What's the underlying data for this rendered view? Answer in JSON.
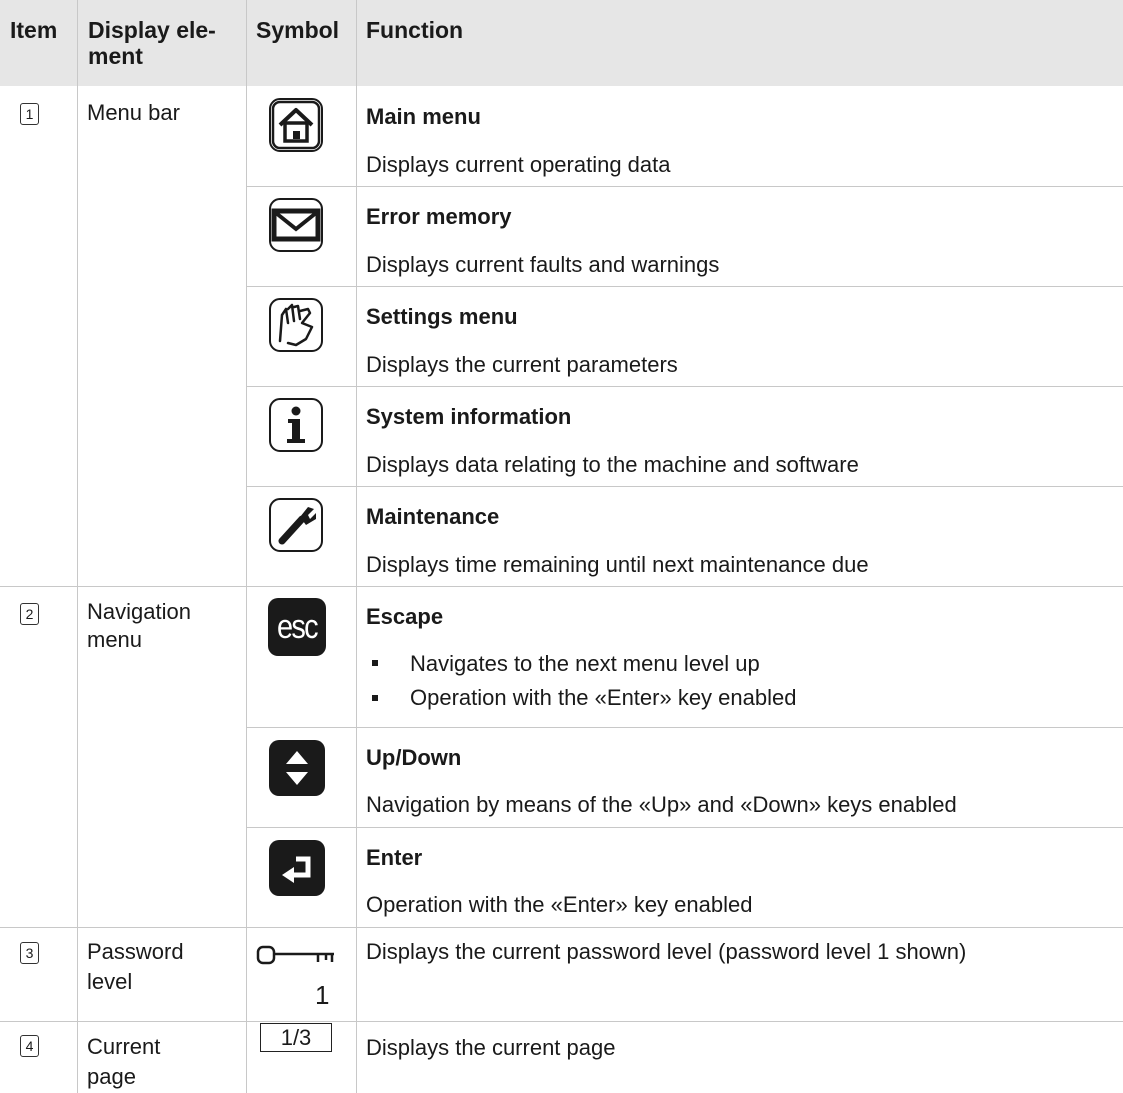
{
  "header": {
    "item": "Item",
    "display_element_line1": "Display ele-",
    "display_element_line2": "ment",
    "symbol": "Symbol",
    "function": "Function"
  },
  "rows": {
    "menu_bar": {
      "item_no": "1",
      "element": "Menu bar",
      "entries": [
        {
          "icon": "home-icon",
          "title": "Main menu",
          "desc": "Displays current operating data"
        },
        {
          "icon": "envelope-icon",
          "title": "Error memory",
          "desc": "Displays current faults and warnings"
        },
        {
          "icon": "hand-icon",
          "title": "Settings menu",
          "desc": "Displays the current parameters"
        },
        {
          "icon": "info-icon",
          "title": "System information",
          "desc": "Displays data relating to the machine and software"
        },
        {
          "icon": "wrench-icon",
          "title": "Maintenance",
          "desc": "Displays time remaining until next maintenance due"
        }
      ]
    },
    "navigation": {
      "item_no": "2",
      "element_line1": "Navigation",
      "element_line2": "menu",
      "escape": {
        "icon": "esc-icon",
        "icon_text": "esc",
        "title": "Escape",
        "bullets": [
          "Navigates to the next menu level up",
          "Operation with the «Enter» key enabled"
        ]
      },
      "updown": {
        "icon": "up-down-icon",
        "title": "Up/Down",
        "desc": "Navigation by means of the «Up» and «Down» keys enabled"
      },
      "enter": {
        "icon": "enter-icon",
        "title": "Enter",
        "desc": "Operation with the «Enter» key enabled"
      }
    },
    "password": {
      "item_no": "3",
      "element_line1": "Password",
      "element_line2": "level",
      "icon": "key-icon",
      "level": "1",
      "desc": "Displays the current password level (password level 1 shown)"
    },
    "current_page": {
      "item_no": "4",
      "element_line1": "Current",
      "element_line2": "page",
      "page_text": "1/3",
      "desc": "Displays the current page"
    }
  },
  "colors": {
    "header_bg": "#e6e6e6",
    "grid": "#c8c8c8",
    "text": "#1a1a1a",
    "icon_fill": "#1a1a1a"
  }
}
